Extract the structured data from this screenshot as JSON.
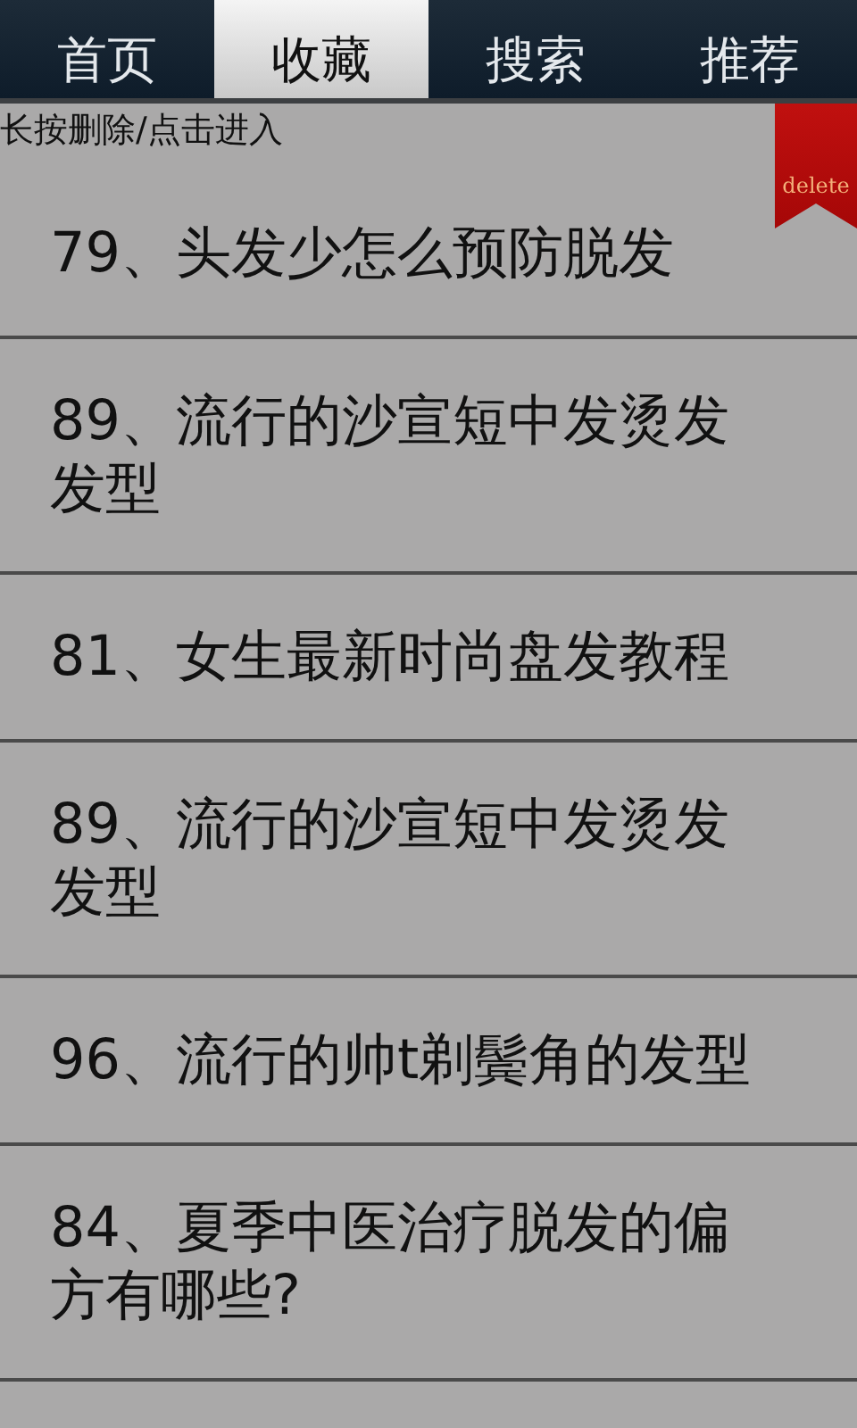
{
  "tabs": [
    {
      "label": "首页",
      "selected": false
    },
    {
      "label": "收藏",
      "selected": true
    },
    {
      "label": "搜索",
      "selected": false
    },
    {
      "label": "推荐",
      "selected": false
    }
  ],
  "hint": "长按删除/点击进入",
  "delete_ribbon": {
    "label": "delete"
  },
  "favorites": [
    {
      "title": "79、头发少怎么预防脱发"
    },
    {
      "title": "89、流行的沙宣短中发烫发发型"
    },
    {
      "title": "81、女生最新时尚盘发教程"
    },
    {
      "title": "89、流行的沙宣短中发烫发发型"
    },
    {
      "title": "96、流行的帅t剃鬓角的发型"
    },
    {
      "title": "84、夏季中医治疗脱发的偏方有哪些?"
    }
  ]
}
